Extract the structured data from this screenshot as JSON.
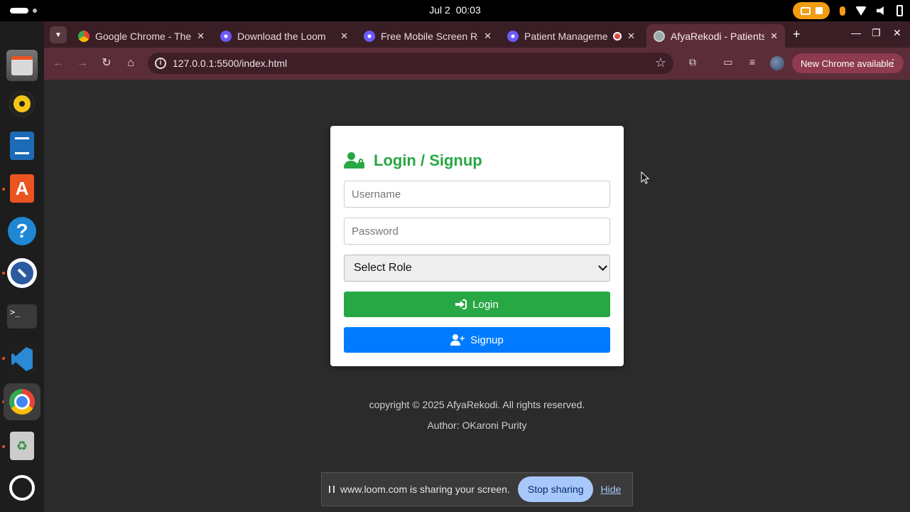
{
  "system": {
    "date": "Jul 2",
    "time": "00:03"
  },
  "browser": {
    "tabs": [
      {
        "title": "Google Chrome - The",
        "favicon": "chrome-icon"
      },
      {
        "title": "Download the Loom",
        "favicon": "loom-icon"
      },
      {
        "title": "Free Mobile Screen Re",
        "favicon": "loom-icon"
      },
      {
        "title": "Patient Manageme",
        "favicon": "loom-icon",
        "recording": true
      },
      {
        "title": "AfyaRekodi - Patients",
        "favicon": "globe-icon",
        "active": true
      }
    ],
    "url": "127.0.0.1:5500/index.html",
    "update_button": "New Chrome available"
  },
  "page": {
    "card_title": "Login / Signup",
    "username_placeholder": "Username",
    "password_placeholder": "Password",
    "role_select": "Select Role",
    "login_button": "Login",
    "signup_button": "Signup",
    "copyright": "copyright © 2025 AfyaRekodi. All rights reserved.",
    "author": "Author: OKaroni Purity",
    "colors": {
      "accent_green": "#28a745",
      "accent_blue": "#007bff",
      "background": "#2b2b2b"
    }
  },
  "share_bar": {
    "message": "www.loom.com is sharing your screen.",
    "stop_label": "Stop sharing",
    "hide_label": "Hide"
  }
}
